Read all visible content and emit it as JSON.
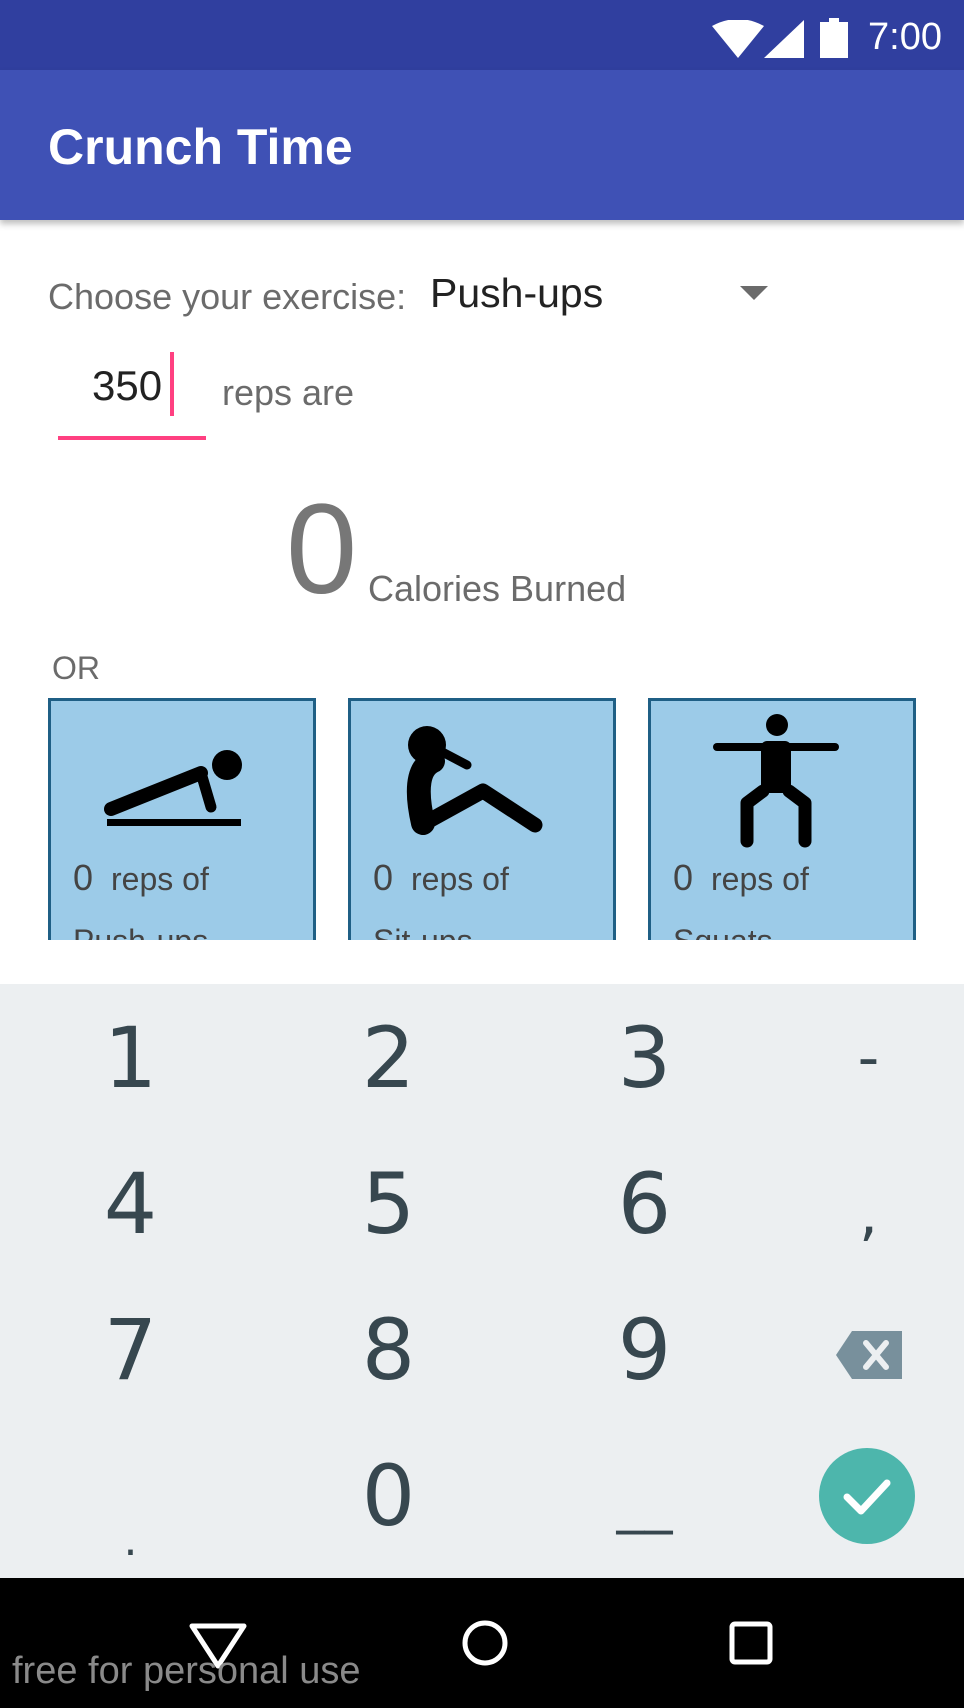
{
  "status_bar": {
    "time": "7:00"
  },
  "app_bar": {
    "title": "Crunch Time"
  },
  "exercise": {
    "label": "Choose your exercise:",
    "selected": "Push-ups"
  },
  "reps": {
    "value": "350",
    "suffix": "reps are"
  },
  "calories": {
    "value": "0",
    "label": "Calories Burned"
  },
  "or_label": "OR",
  "cards": [
    {
      "count": "0",
      "reps_label": "reps of",
      "name": "Push-ups",
      "icon": "push-up-icon"
    },
    {
      "count": "0",
      "reps_label": "reps of",
      "name": "Sit-ups",
      "icon": "sit-up-icon"
    },
    {
      "count": "0",
      "reps_label": "reps of",
      "name": "Squats",
      "icon": "squat-icon"
    }
  ],
  "keyboard": {
    "keys": [
      "1",
      "2",
      "3",
      "-",
      "4",
      "5",
      "6",
      ",",
      "7",
      "8",
      "9",
      "0",
      ".",
      "__"
    ],
    "backspace_icon": "backspace-icon",
    "done_icon": "check-icon"
  },
  "colors": {
    "status_bar": "#303f9f",
    "app_bar": "#3f51b5",
    "accent": "#ff4081",
    "card_bg": "#9ccbe8",
    "card_border": "#1f5f85",
    "done_button": "#4db6ac"
  },
  "nav_bar": {
    "icons": [
      "back-icon",
      "home-icon",
      "recents-icon"
    ]
  },
  "watermark": "free for personal use"
}
